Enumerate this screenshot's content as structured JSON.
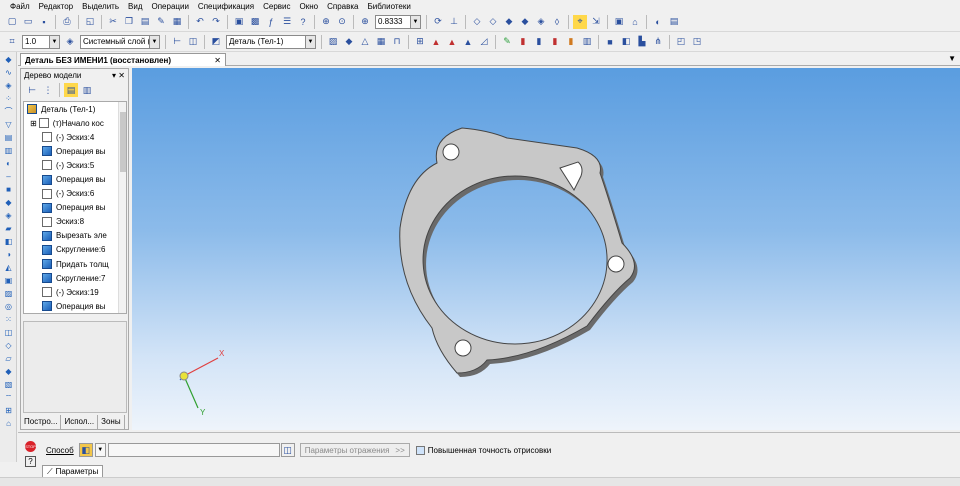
{
  "menu": [
    "Файл",
    "Редактор",
    "Выделить",
    "Вид",
    "Операции",
    "Спецификация",
    "Сервис",
    "Окно",
    "Справка",
    "Библиотеки"
  ],
  "toolbar": {
    "zoom_value": "0.8333",
    "line_width": "1.0",
    "layer": "Системный слой (0)",
    "part": "Деталь (Тел-1)"
  },
  "document_tab": {
    "title": "Деталь БЕЗ ИМЕНИ1 (восстановлен)",
    "close": "✕"
  },
  "tree": {
    "title": "Дерево модели",
    "controls": "▾ ✕",
    "items": [
      {
        "label": "Деталь (Тел-1)",
        "type": "part"
      },
      {
        "label": "(т)Начало кос",
        "type": "origin"
      },
      {
        "label": "(-) Эскиз:4",
        "type": "sketch"
      },
      {
        "label": "Операция вы",
        "type": "op"
      },
      {
        "label": "(-) Эскиз:5",
        "type": "sketch"
      },
      {
        "label": "Операция вы",
        "type": "op"
      },
      {
        "label": "(-) Эскиз:6",
        "type": "sketch"
      },
      {
        "label": "Операция вы",
        "type": "op"
      },
      {
        "label": "Эскиз:8",
        "type": "sketch"
      },
      {
        "label": "Вырезать эле",
        "type": "op"
      },
      {
        "label": "Скругление:6",
        "type": "op"
      },
      {
        "label": "Придать толщ",
        "type": "op"
      },
      {
        "label": "Скругление:7",
        "type": "op"
      },
      {
        "label": "(-) Эскиз:19",
        "type": "sketch"
      },
      {
        "label": "Операция вы",
        "type": "op"
      }
    ],
    "bottom_tabs": [
      "Постро...",
      "Испол...",
      "Зоны"
    ]
  },
  "axes": {
    "x": "X",
    "y": "Y"
  },
  "bottom": {
    "method_label": "Способ",
    "reflection_params": "Параметры отражения",
    "reflection_arrows": ">>",
    "precision_label": "Повышенная точность отрисовки",
    "params_tab": "Параметры",
    "stop_label": "STOP",
    "help_label": "?"
  },
  "colors": {
    "viewport_top": "#5a9de0",
    "viewport_bottom": "#eef4fb",
    "part_fill": "#c8c8c8",
    "axis_x": "#e04040",
    "axis_y": "#30a030"
  }
}
